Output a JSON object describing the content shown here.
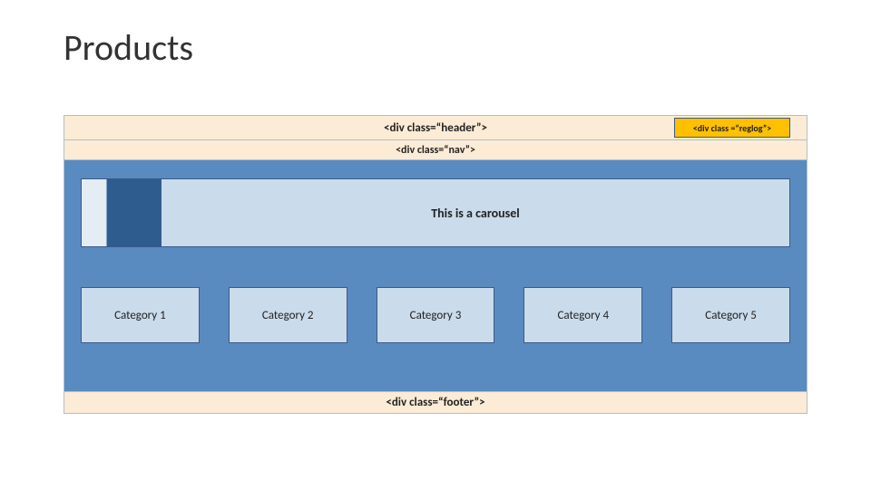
{
  "title": "Products",
  "header_label": "<div class=“header”>",
  "reglog_label": "<div class =“reglog”>",
  "nav_label": "<div class=“nav”>",
  "carousel_label": "This is a carousel",
  "categories": [
    "Category 1",
    "Category 2",
    "Category 3",
    "Category 4",
    "Category 5"
  ],
  "footer_label": "<div class=“footer”>",
  "colors": {
    "cream": "#fcebd5",
    "blue_main": "#5a8bc0",
    "light_blue": "#cadbec",
    "dark_blue": "#2f5c8f",
    "yellow": "#ffc000"
  }
}
